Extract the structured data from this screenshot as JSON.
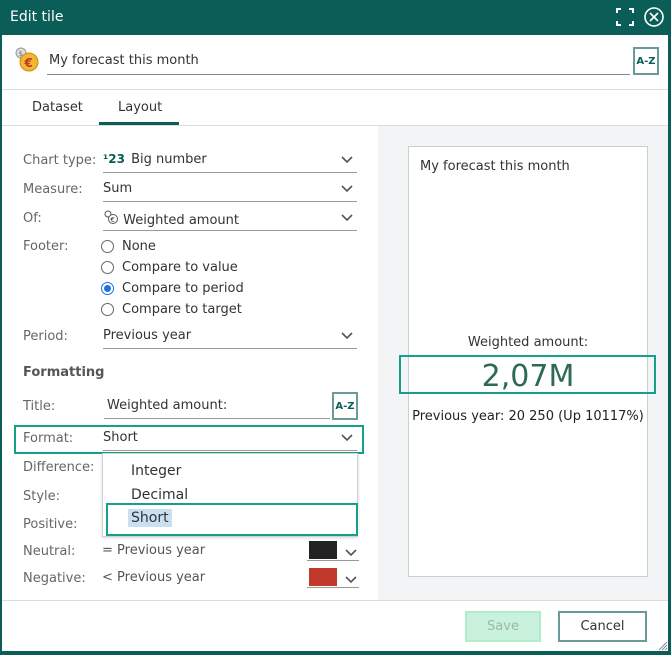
{
  "window": {
    "title": "Edit tile",
    "maximize_icon": "maximize-icon",
    "close_icon": "close-circle-icon"
  },
  "header": {
    "tile_name": "My forecast this month",
    "coin_icon": "euro-coin-icon",
    "translate_label": "A-Z"
  },
  "tabs": [
    {
      "label": "Dataset",
      "active": false
    },
    {
      "label": "Layout",
      "active": true
    }
  ],
  "form": {
    "chart_type": {
      "label": "Chart type:",
      "value": "Big number",
      "icon_text": "¹23"
    },
    "measure": {
      "label": "Measure:",
      "value": "Sum"
    },
    "of": {
      "label": "Of:",
      "value": "Weighted amount"
    },
    "footer": {
      "label": "Footer:",
      "options": [
        "None",
        "Compare to value",
        "Compare to period",
        "Compare to target"
      ],
      "selected": "Compare to period"
    },
    "period": {
      "label": "Period:",
      "value": "Previous year"
    },
    "formatting_heading": "Formatting",
    "title": {
      "label": "Title:",
      "value": "Weighted amount:",
      "translate_label": "A-Z"
    },
    "format": {
      "label": "Format:",
      "value": "Short",
      "options": [
        "Integer",
        "Decimal",
        "Short"
      ]
    },
    "difference": {
      "label": "Difference:"
    },
    "style": {
      "label": "Style:"
    },
    "positive": {
      "label": "Positive:"
    },
    "neutral": {
      "label": "Neutral:",
      "text": "= Previous year",
      "color": "#222222"
    },
    "negative": {
      "label": "Negative:",
      "text": "< Previous year",
      "color": "#c0392b"
    }
  },
  "preview": {
    "title": "My forecast this month",
    "subtitle": "Weighted amount:",
    "value": "2,07M",
    "footer": "Previous year: 20 250 (Up 10117%)"
  },
  "buttons": {
    "save": "Save",
    "cancel": "Cancel"
  }
}
